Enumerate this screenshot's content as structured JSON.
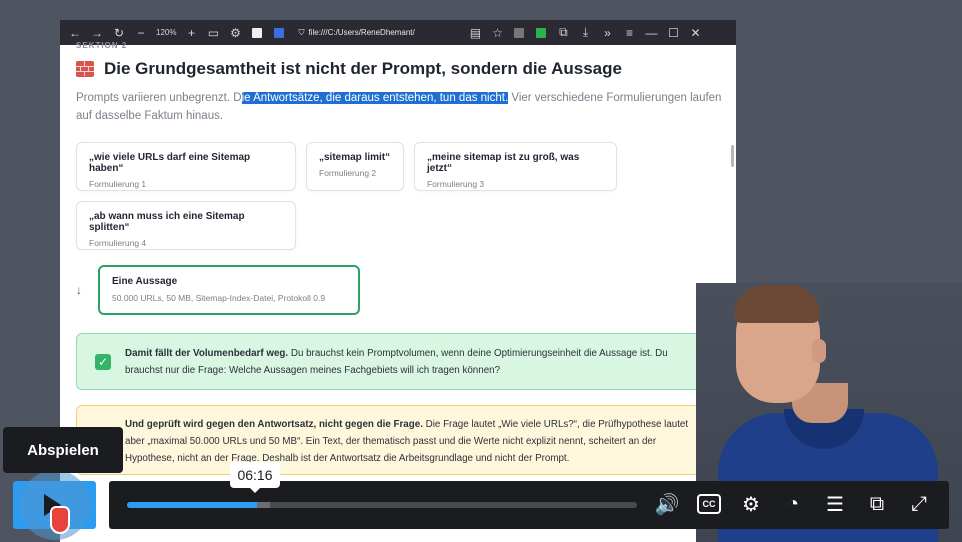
{
  "browser": {
    "zoom": "120%",
    "url": "file:///C:/Users/ReneDhemant/",
    "icons": [
      "back-icon",
      "forward-icon",
      "reload-icon",
      "zoom-out-icon",
      "zoom-in-icon",
      "shield-icon",
      "star-icon",
      "download-icon",
      "menu-icon"
    ]
  },
  "page": {
    "section": "SEKTION 2",
    "title": "Die Grundgesamtheit ist nicht der Prompt, sondern die Aussage",
    "intro_pre": "Prompts variieren unbegrenzt. D",
    "intro_hl": "ie Antwortsätze, die daraus entstehen, tun das nicht.",
    "intro_post": " Vier verschiedene Formulierungen laufen auf dasselbe Faktum hinaus.",
    "formulations": [
      {
        "q": "„wie viele URLs darf eine Sitemap haben“",
        "s": "Formulierung 1"
      },
      {
        "q": "„sitemap limit“",
        "s": "Formulierung 2"
      },
      {
        "q": "„meine sitemap ist zu groß, was jetzt“",
        "s": "Formulierung 3"
      },
      {
        "q": "„ab wann muss ich eine Sitemap splitten“",
        "s": "Formulierung 4"
      }
    ],
    "aussage": {
      "title": "Eine Aussage",
      "sub": "50.000 URLs, 50 MB, Sitemap-Index-Datei, Protokoll 0.9"
    },
    "green_bold": "Damit fällt der Volumenbedarf weg.",
    "green_text": " Du brauchst kein Promptvolumen, wenn deine Optimierungseinheit die Aussage ist. Du brauchst nur die Frage: Welche Aussagen meines Fachgebiets will ich tragen können?",
    "yellow_bold": "Und geprüft wird gegen den Antwortsatz, nicht gegen die Frage.",
    "yellow_text": " Die Frage lautet „Wie viele URLs?“, die Prüfhypothese lautet aber „maximal 50.000 URLs und 50 MB“. Ein Text, der thematisch passt und die Werte nicht explizit nennt, scheitert an der Hypothese, nicht an der Frage. Deshalb ist der Antwortsatz die Arbeitsgrundlage und nicht der Prompt."
  },
  "player": {
    "tooltip": "Abspielen",
    "time": "06:16",
    "progress": 0.255,
    "buffered": 0.28,
    "cc_label": "CC",
    "accent": "#2d9bf0"
  }
}
